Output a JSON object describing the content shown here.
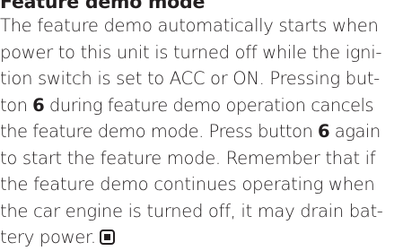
{
  "section": {
    "heading": "Feature demo mode",
    "lines": [
      "The feature demo automatically starts when",
      "power to this unit is turned off while the igni-",
      "tion switch is set to ACC or ON. Pressing but-",
      [
        "ton ",
        "6",
        " during feature demo operation cancels"
      ],
      "the feature demo mode. Press button 6 again",
      "to start the feature mode. Remember that if",
      "the feature demo continues operating when",
      "the car engine is turned off, it may drain bat-",
      "tery power."
    ],
    "line4_pre": "ton ",
    "button_number": "6",
    "line4_post": " during feature demo operation cancels",
    "line5_pre": "the feature demo mode. Press button ",
    "line5_post": " again",
    "end_icon": "end-of-section-icon"
  }
}
